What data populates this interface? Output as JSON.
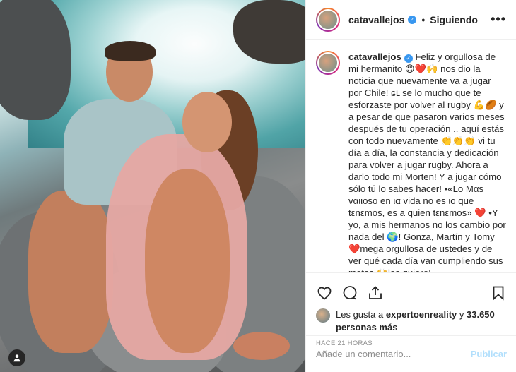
{
  "post": {
    "username": "catavallejos",
    "follow_separator": "•",
    "follow_label": "Siguiendo",
    "more_label": "•••",
    "caption_user": "catavallejos",
    "caption_text": "Feliz y orgullosa de mi hermanito 😍❤️🙌 nos dio la noticia que nuevamente va a jugar por Chile! ɕւ se lo mucho que te esforzaste por volver al rugby 💪🏉 y a pesar de que pasaron varios meses después de tu operación .. aquí estás con todo nuevamente 👏👏👏 vi tu día a día, la constancia y dedicación para volver a jugar rugby. Ahora a darlo todo mi Morten! Y a jugar cómo sólo tú lo sabes hacer! •«Lo Mαs vαιιoso en ια vida no es ιo que tεnεmos, es a quien tεnεmos» ❤️ •Y yo, a mis hermanos no los cambio por nada del 🌍! Gonza, Martín y Tomy❤️mega orgullosa de ustedes y de ver qué cada día van cumpliendo sus metas 🙌los quiero!",
    "likes_prefix": "Les gusta a ",
    "likes_user": "expertoenreality",
    "likes_mid": " y ",
    "likes_count": "33.650 personas más",
    "timestamp": "Hace 21 horas",
    "comment_placeholder": "Añade un comentario...",
    "publish_label": "Publicar"
  },
  "icons": {
    "verified": "verified-badge-icon",
    "like": "heart-icon",
    "comment": "comment-icon",
    "share": "share-icon",
    "save": "bookmark-icon",
    "tag": "user-tag-icon"
  },
  "colors": {
    "accent": "#3897f0",
    "publish_disabled": "#b2dffc",
    "muted": "#8e8e8e"
  }
}
